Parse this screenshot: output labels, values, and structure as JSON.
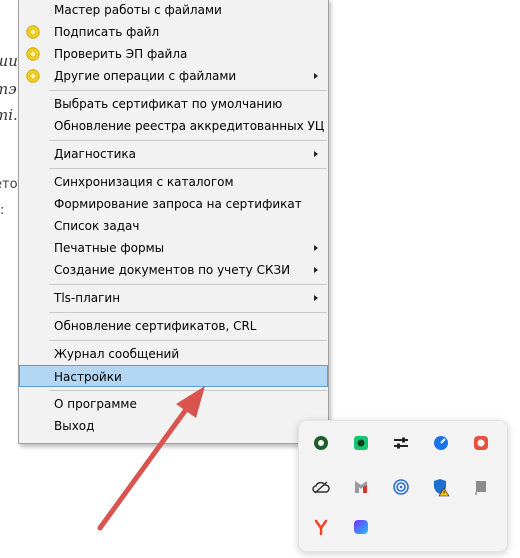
{
  "background_text": [
    "ши",
    "тэ",
    "ті.",
    "ето",
    ":"
  ],
  "menu": {
    "items": [
      {
        "label": "Мастер работы с файлами",
        "icon": "",
        "submenu": false
      },
      {
        "label": "Подписать файл",
        "icon": "certificate-seal-icon",
        "submenu": false
      },
      {
        "label": "Проверить ЭП файла",
        "icon": "certificate-seal-icon",
        "submenu": false
      },
      {
        "label": "Другие операции с файлами",
        "icon": "certificate-seal-icon",
        "submenu": true
      },
      {
        "label": "Выбрать сертификат по умолчанию",
        "icon": "",
        "submenu": false
      },
      {
        "label": "Обновление реестра аккредитованных УЦ",
        "icon": "",
        "submenu": false
      },
      {
        "label": "Диагностика",
        "icon": "",
        "submenu": true
      },
      {
        "label": "Синхронизация с каталогом",
        "icon": "",
        "submenu": false
      },
      {
        "label": "Формирование запроса на сертификат",
        "icon": "",
        "submenu": false
      },
      {
        "label": "Список задач",
        "icon": "",
        "submenu": false
      },
      {
        "label": "Печатные формы",
        "icon": "",
        "submenu": true
      },
      {
        "label": "Создание документов по учету СКЗИ",
        "icon": "",
        "submenu": true
      },
      {
        "label": "Tls-плагин",
        "icon": "",
        "submenu": true
      },
      {
        "label": "Обновление сертификатов, CRL",
        "icon": "",
        "submenu": false
      },
      {
        "label": "Журнал сообщений",
        "icon": "",
        "submenu": false
      },
      {
        "label": "Настройки",
        "icon": "",
        "submenu": false,
        "highlighted": true
      },
      {
        "label": "О программе",
        "icon": "",
        "submenu": false
      },
      {
        "label": "Выход",
        "icon": "",
        "submenu": false
      }
    ]
  },
  "tray": {
    "icons": [
      "green-circle-app-icon",
      "green-messenger-icon",
      "sliders-icon",
      "blue-speedometer-icon",
      "red-app-icon",
      "cloud-icon",
      "m-shield-icon",
      "blue-spiral-icon",
      "shield-warning-icon",
      "gray-flag-icon",
      "yandex-y-icon",
      "gradient-app-icon"
    ]
  },
  "colors": {
    "highlight": "#b3d7f3",
    "highlight_border": "#5a9fd6",
    "annotation_arrow": "#d9534f"
  }
}
